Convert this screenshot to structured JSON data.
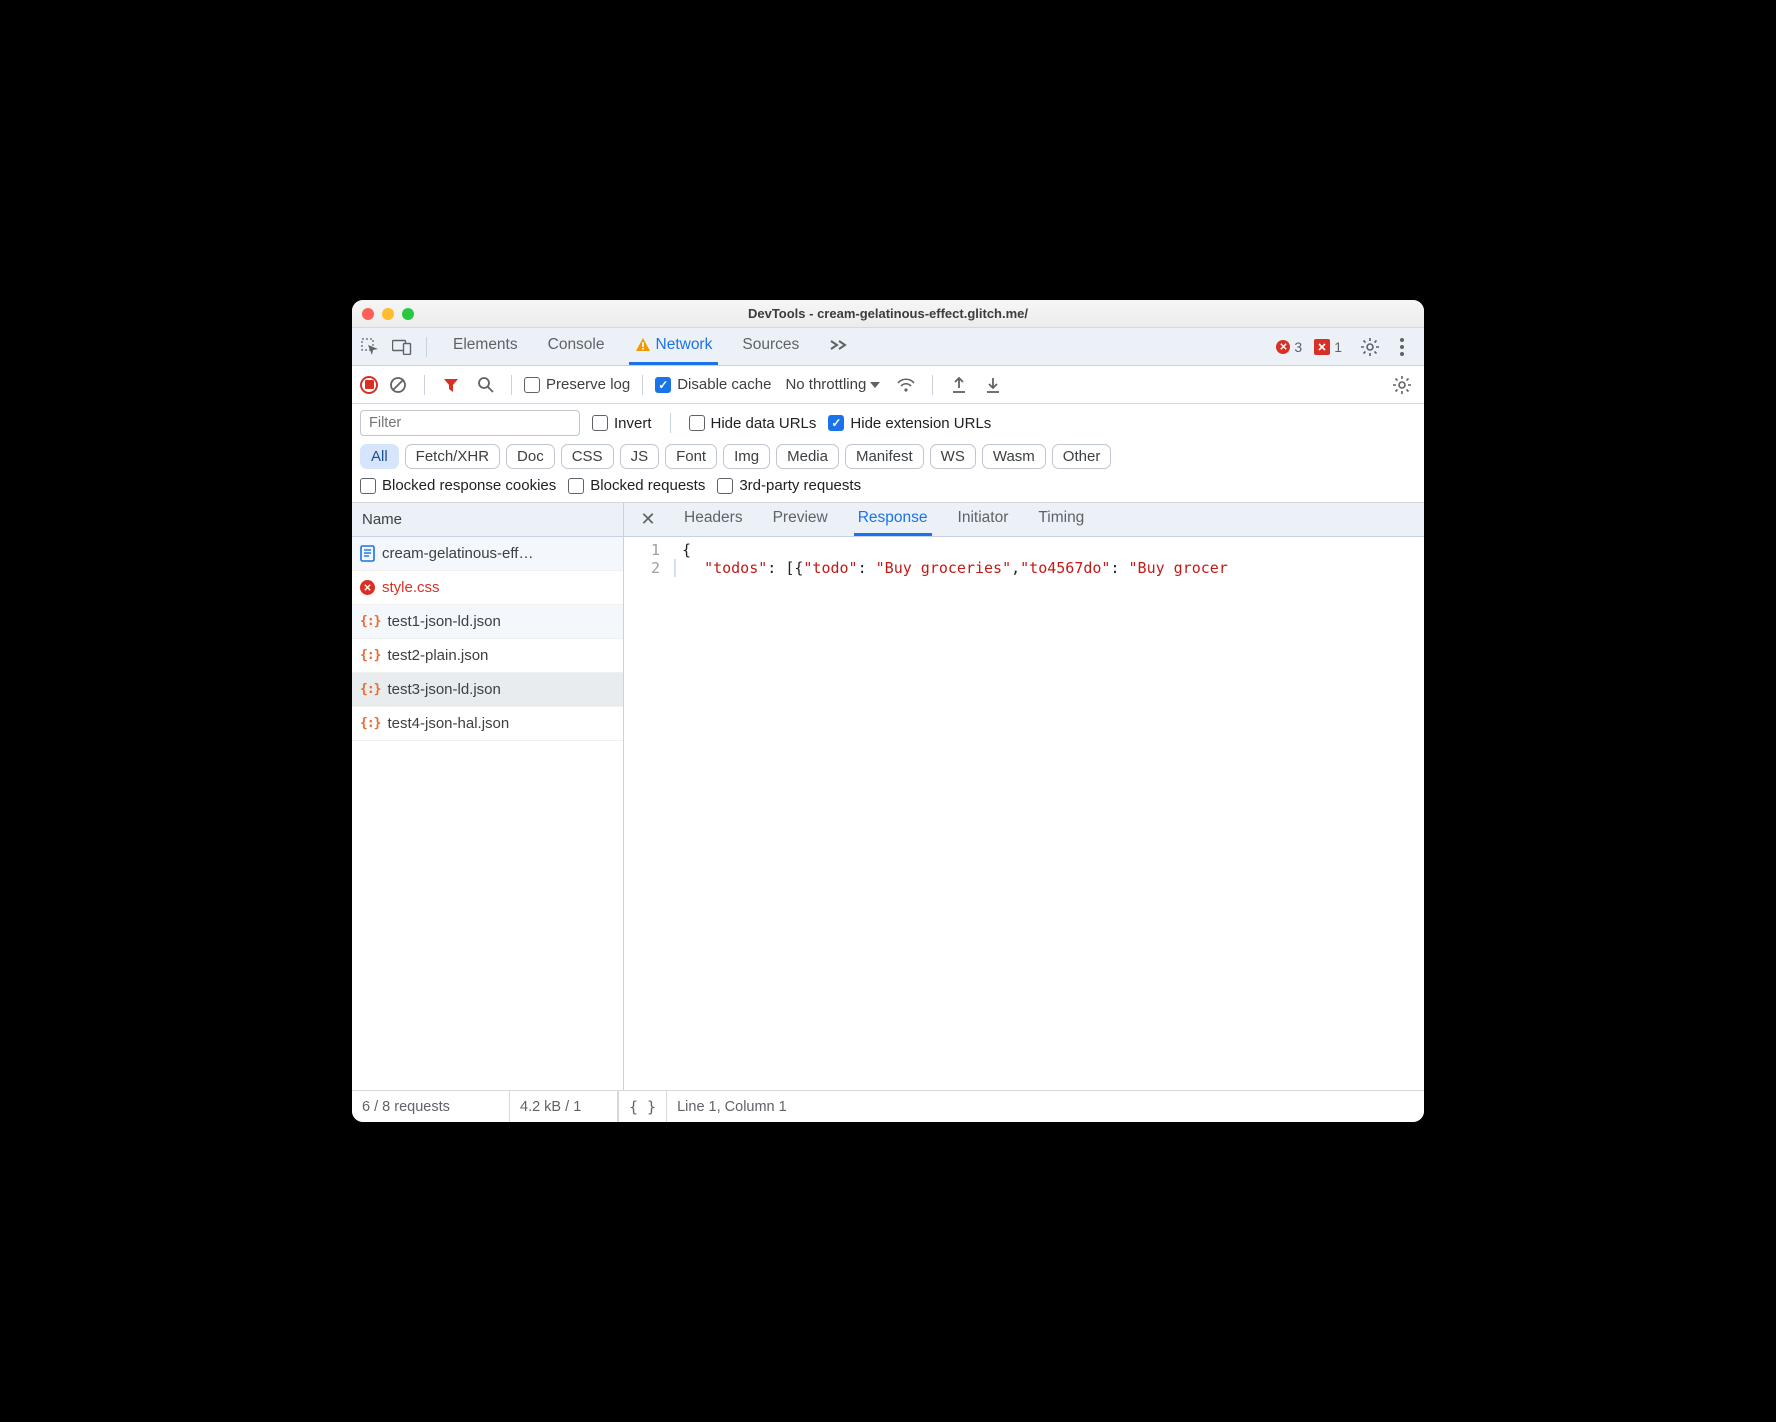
{
  "window": {
    "title": "DevTools - cream-gelatinous-effect.glitch.me/"
  },
  "tabs": {
    "items": [
      "Elements",
      "Console",
      "Network",
      "Sources"
    ],
    "active": "Network",
    "errors_count": "3",
    "issues_count": "1"
  },
  "toolbar": {
    "preserve_log": "Preserve log",
    "disable_cache": "Disable cache",
    "throttling": "No throttling"
  },
  "filter": {
    "placeholder": "Filter",
    "invert": "Invert",
    "hide_data_urls": "Hide data URLs",
    "hide_ext_urls": "Hide extension URLs",
    "types": [
      "All",
      "Fetch/XHR",
      "Doc",
      "CSS",
      "JS",
      "Font",
      "Img",
      "Media",
      "Manifest",
      "WS",
      "Wasm",
      "Other"
    ],
    "active_type": "All",
    "blocked_cookies": "Blocked response cookies",
    "blocked_requests": "Blocked requests",
    "third_party": "3rd-party requests"
  },
  "requests": {
    "header": "Name",
    "items": [
      {
        "name": "cream-gelatinous-eff…",
        "icon": "doc",
        "state": "stripe"
      },
      {
        "name": "style.css",
        "icon": "err",
        "state": "err"
      },
      {
        "name": "test1-json-ld.json",
        "icon": "json",
        "state": "stripe"
      },
      {
        "name": "test2-plain.json",
        "icon": "json",
        "state": ""
      },
      {
        "name": "test3-json-ld.json",
        "icon": "json",
        "state": "sel"
      },
      {
        "name": "test4-json-hal.json",
        "icon": "json",
        "state": ""
      }
    ]
  },
  "detail_tabs": {
    "items": [
      "Headers",
      "Preview",
      "Response",
      "Initiator",
      "Timing"
    ],
    "active": "Response"
  },
  "response": {
    "lines": [
      {
        "n": "1",
        "text": "{"
      },
      {
        "n": "2",
        "text": "  \"todos\": [{\"todo\": \"Buy groceries\",\"to4567do\": \"Buy grocer"
      }
    ]
  },
  "status": {
    "requests": "6 / 8 requests",
    "transfer": "4.2 kB / 1",
    "cursor": "Line 1, Column 1"
  }
}
